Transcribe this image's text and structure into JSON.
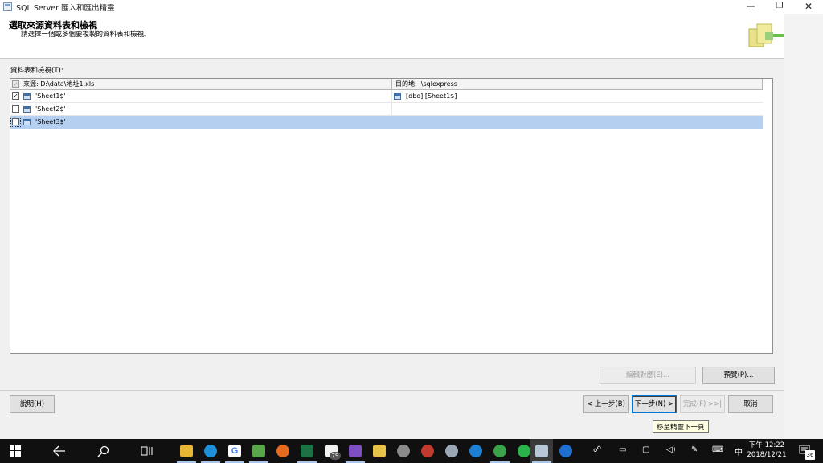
{
  "window": {
    "title": "SQL Server 匯入和匯出精靈",
    "minimize": "—",
    "maximize": "❐",
    "close": "✕"
  },
  "header": {
    "title": "選取來源資料表和檢視",
    "subtitle": "請選擇一個或多個要複製的資料表和檢視。"
  },
  "list_label": "資料表和檢視(T):",
  "grid": {
    "source_header": "來源: D:\\data\\地址1.xls",
    "dest_header": "目的地: .\\sqlexpress",
    "rows": [
      {
        "source": "'Sheet1$'",
        "destination": "[dbo].[Sheet1$]",
        "checked": true,
        "selected": false
      },
      {
        "source": "'Sheet2$'",
        "destination": "",
        "checked": false,
        "selected": false
      },
      {
        "source": "'Sheet3$'",
        "destination": "",
        "checked": false,
        "selected": true
      }
    ]
  },
  "buttons": {
    "edit_mapping": "編輯對應(E)...",
    "preview": "預覽(P)...",
    "help": "說明(H)",
    "back": "< 上一步(B)",
    "next": "下一步(N) >",
    "finish": "完成(F) >>|",
    "cancel": "取消"
  },
  "tooltip": "移至精靈下一頁",
  "taskbar": {
    "clock_time": "下午 12:22",
    "clock_date": "2018/12/21",
    "ime": "中",
    "notification_count": "36",
    "badge_count": "79"
  },
  "colors": {
    "selection": "#b4cff0",
    "taskbar": "#101010",
    "accent": "#0078d7"
  }
}
